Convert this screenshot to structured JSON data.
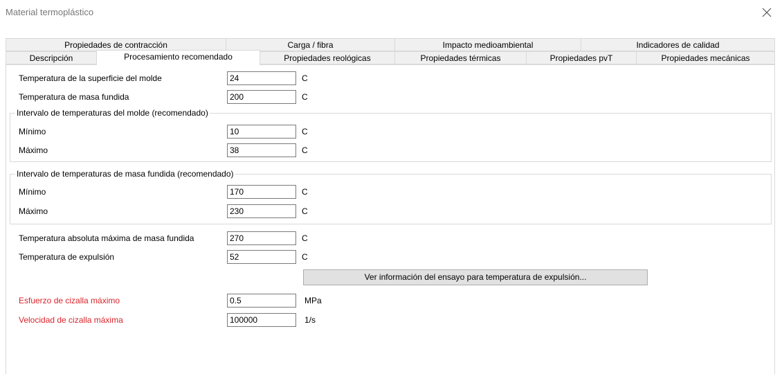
{
  "window": {
    "title": "Material termoplástico"
  },
  "tabs_row1": [
    {
      "label": "Propiedades de contracción"
    },
    {
      "label": "Carga / fibra"
    },
    {
      "label": "Impacto medioambiental"
    },
    {
      "label": "Indicadores de calidad"
    }
  ],
  "tabs_row2": [
    {
      "label": "Descripción"
    },
    {
      "label": "Procesamiento recomendado",
      "active": true
    },
    {
      "label": "Propiedades reológicas"
    },
    {
      "label": "Propiedades térmicas"
    },
    {
      "label": "Propiedades pvT"
    },
    {
      "label": "Propiedades mecánicas"
    }
  ],
  "fields": {
    "mold_surface_temp": {
      "label": "Temperatura de la superficie del molde",
      "value": "24",
      "unit": "C"
    },
    "melt_temp": {
      "label": "Temperatura de masa fundida",
      "value": "200",
      "unit": "C"
    },
    "abs_max_melt_temp": {
      "label": "Temperatura absoluta máxima de masa fundida",
      "value": "270",
      "unit": "C"
    },
    "ejection_temp": {
      "label": "Temperatura de expulsión",
      "value": "52",
      "unit": "C"
    },
    "max_shear_stress": {
      "label": "Esfuerzo de cizalla máximo",
      "value": "0.5",
      "unit": "MPa"
    },
    "max_shear_rate": {
      "label": "Velocidad de cizalla máxima",
      "value": "100000",
      "unit": "1/s"
    }
  },
  "mold_range": {
    "title": "Intervalo de temperaturas del molde (recomendado)",
    "min": {
      "label": "Mínimo",
      "value": "10",
      "unit": "C"
    },
    "max": {
      "label": "Máximo",
      "value": "38",
      "unit": "C"
    }
  },
  "melt_range": {
    "title": "Intervalo de temperaturas de masa fundida (recomendado)",
    "min": {
      "label": "Mínimo",
      "value": "170",
      "unit": "C"
    },
    "max": {
      "label": "Máximo",
      "value": "230",
      "unit": "C"
    }
  },
  "buttons": {
    "ejection_info": "Ver información del ensayo para temperatura de expulsión..."
  },
  "colors": {
    "required_label": "#d9242a",
    "tab_bg": "#f0f0f0",
    "border": "#d9d9d9"
  },
  "icons": {
    "close": "close-icon"
  }
}
